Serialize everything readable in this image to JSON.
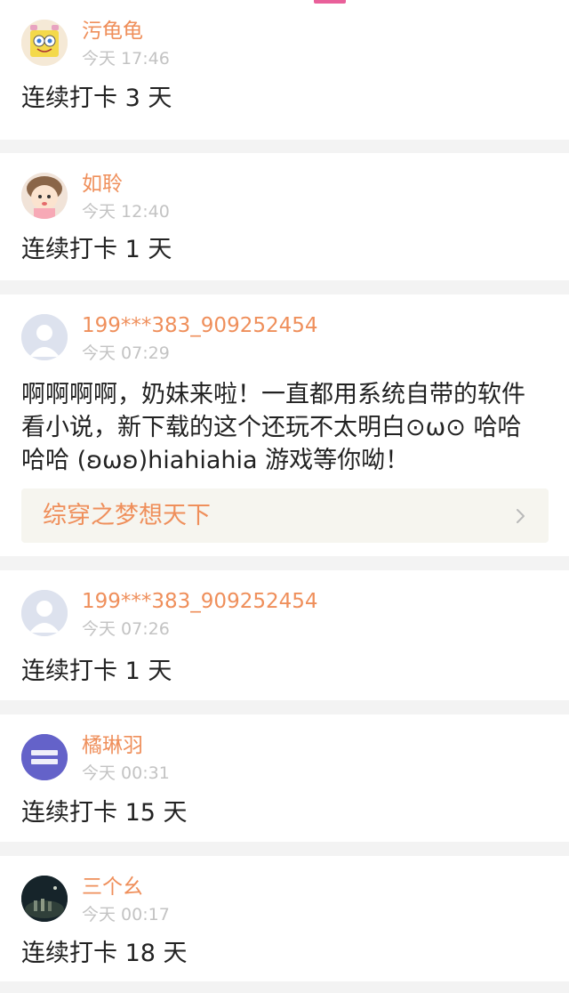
{
  "feed": {
    "posts": [
      {
        "username": "污龟龟",
        "time": "今天 17:46",
        "content": "连续打卡 3 天",
        "avatar_icon": "spongebob-avatar-icon"
      },
      {
        "username": "如聆",
        "time": "今天 12:40",
        "content": "连续打卡 1 天",
        "avatar_icon": "cartoon-girl-avatar-icon"
      },
      {
        "username": "199***383_909252454",
        "time": "今天 07:29",
        "content": "啊啊啊啊，奶妹来啦！一直都用系统自带的软件看小说，新下载的这个还玩不太明白⊙ω⊙ 哈哈哈哈 (ʚωʚ)hiahiahia 游戏等你呦！",
        "book_title": "综穿之梦想天下",
        "avatar_icon": "default-user-avatar-icon"
      },
      {
        "username": "199***383_909252454",
        "time": "今天 07:26",
        "content": "连续打卡 1 天",
        "avatar_icon": "default-user-avatar-icon"
      },
      {
        "username": "橘琳羽",
        "time": "今天 00:31",
        "content": "连续打卡 15 天",
        "avatar_icon": "purple-text-avatar-icon"
      },
      {
        "username": "三个幺",
        "time": "今天 00:17",
        "content": "连续打卡 18 天",
        "avatar_icon": "night-photo-avatar-icon"
      }
    ]
  },
  "colors": {
    "accent": "#ef8f5b",
    "indicator": "#e9609a",
    "background": "#f3f3f3",
    "time_text": "#c3c3c3",
    "content_text": "#222222"
  }
}
